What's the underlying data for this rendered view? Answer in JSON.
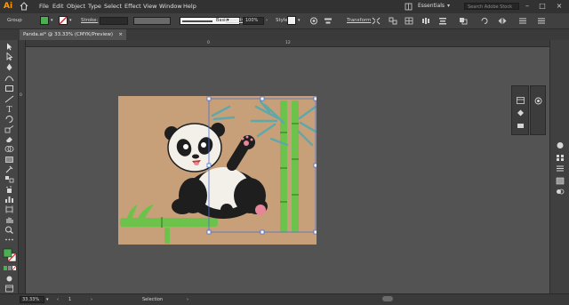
{
  "app": {
    "logo": "Ai"
  },
  "menu": {
    "items": [
      "File",
      "Edit",
      "Object",
      "Type",
      "Select",
      "Effect",
      "View",
      "Window",
      "Help"
    ],
    "workspace": "Essentials",
    "search_placeholder": "Search Adobe Stock"
  },
  "control_bar": {
    "selection_type": "Group",
    "stroke_label": "Stroke:",
    "brush_label": "Basic",
    "opacity_label": "Opacity:",
    "opacity_value": "100%",
    "style_label": "Style:",
    "transform_label": "Transform",
    "fill_color": "#4caf50"
  },
  "document": {
    "tab_title": "Panda.ai* @ 33.33% (CMYK/Preview)",
    "close_glyph": "×"
  },
  "rulers": {
    "top_marks": [
      "0",
      "12"
    ],
    "left_marks": [
      "0"
    ]
  },
  "status": {
    "zoom": "33.33%",
    "artboard_number": "1",
    "tool_name": "Selection"
  },
  "colors": {
    "artboard": "#c7a07a",
    "bamboo": "#6cc24a",
    "leaf": "#5fa8a8",
    "panda_black": "#1e1e1e",
    "panda_white": "#f3f0ea",
    "selection": "#4a6fd1"
  }
}
